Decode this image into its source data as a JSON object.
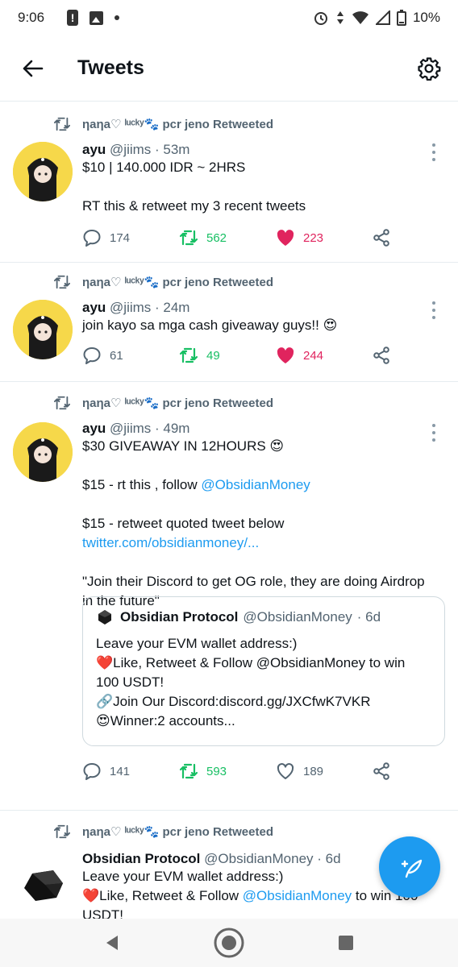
{
  "status_bar": {
    "time": "9:06",
    "battery": "10%"
  },
  "header": {
    "title": "Tweets"
  },
  "tweets": [
    {
      "retweeted_by": "ηaηa♡ ˡᵘᶜᵏʸ🐾 pcr jeno Retweeted",
      "name": "ayu",
      "handle": "@jiims",
      "time": "· 53m",
      "lines": [
        "$10 | 140.000 IDR ~ 2HRS",
        "RT this & retweet my 3 recent tweets"
      ],
      "replies": "174",
      "retweets": "562",
      "likes": "223"
    },
    {
      "retweeted_by": "ηaηa♡ ˡᵘᶜᵏʸ🐾 pcr jeno Retweeted",
      "name": "ayu",
      "handle": "@jiims",
      "time": "· 24m",
      "lines": [
        "join kayo sa mga cash giveaway guys!! 😍"
      ],
      "replies": "61",
      "retweets": "49",
      "likes": "244"
    },
    {
      "retweeted_by": "ηaηa♡ ˡᵘᶜᵏʸ🐾 pcr jeno Retweeted",
      "name": "ayu",
      "handle": "@jiims",
      "time": "· 49m",
      "line1": "$30 GIVEAWAY IN 12HOURS 😍",
      "line2_prefix": "$15 - rt this , follow ",
      "line2_mention": "@ObsidianMoney",
      "line3": "$15 - retweet quoted tweet below",
      "line4_link": "twitter.com/obsidianmoney/...",
      "line5": "\"Join their Discord to get OG role, they are doing Airdrop in the future\"",
      "quote": {
        "name": "Obsidian Protocol",
        "handle": "@ObsidianMoney",
        "time": "· 6d",
        "lines": [
          "Leave your EVM wallet address:)",
          "❤️Like, Retweet & Follow @ObsidianMoney to win 100 USDT!",
          "🔗Join Our Discord:discord.gg/JXCfwK7VKR",
          "😍Winner:2 accounts..."
        ]
      },
      "replies": "141",
      "retweets": "593",
      "likes": "189"
    },
    {
      "retweeted_by": "ηaηa♡ ˡᵘᶜᵏʸ🐾 pcr jeno Retweeted",
      "name": "Obsidian Protocol",
      "handle": "@ObsidianMoney",
      "time": "· 6d",
      "line1": "Leave your EVM wallet address:)",
      "line2_prefix": "❤️Like, Retweet & Follow ",
      "line2_mention": "@ObsidianMoney",
      "line2_suffix": " to win 100",
      "line3": "USDT!"
    }
  ],
  "colors": {
    "accent": "#1d9bf0",
    "retweet": "#17bf63",
    "like": "#e0245e",
    "muted": "#536471"
  },
  "icons": [
    "back-arrow-icon",
    "settings-gear-icon",
    "retweet-icon",
    "reply-icon",
    "like-icon",
    "share-icon",
    "more-icon",
    "compose-icon"
  ]
}
